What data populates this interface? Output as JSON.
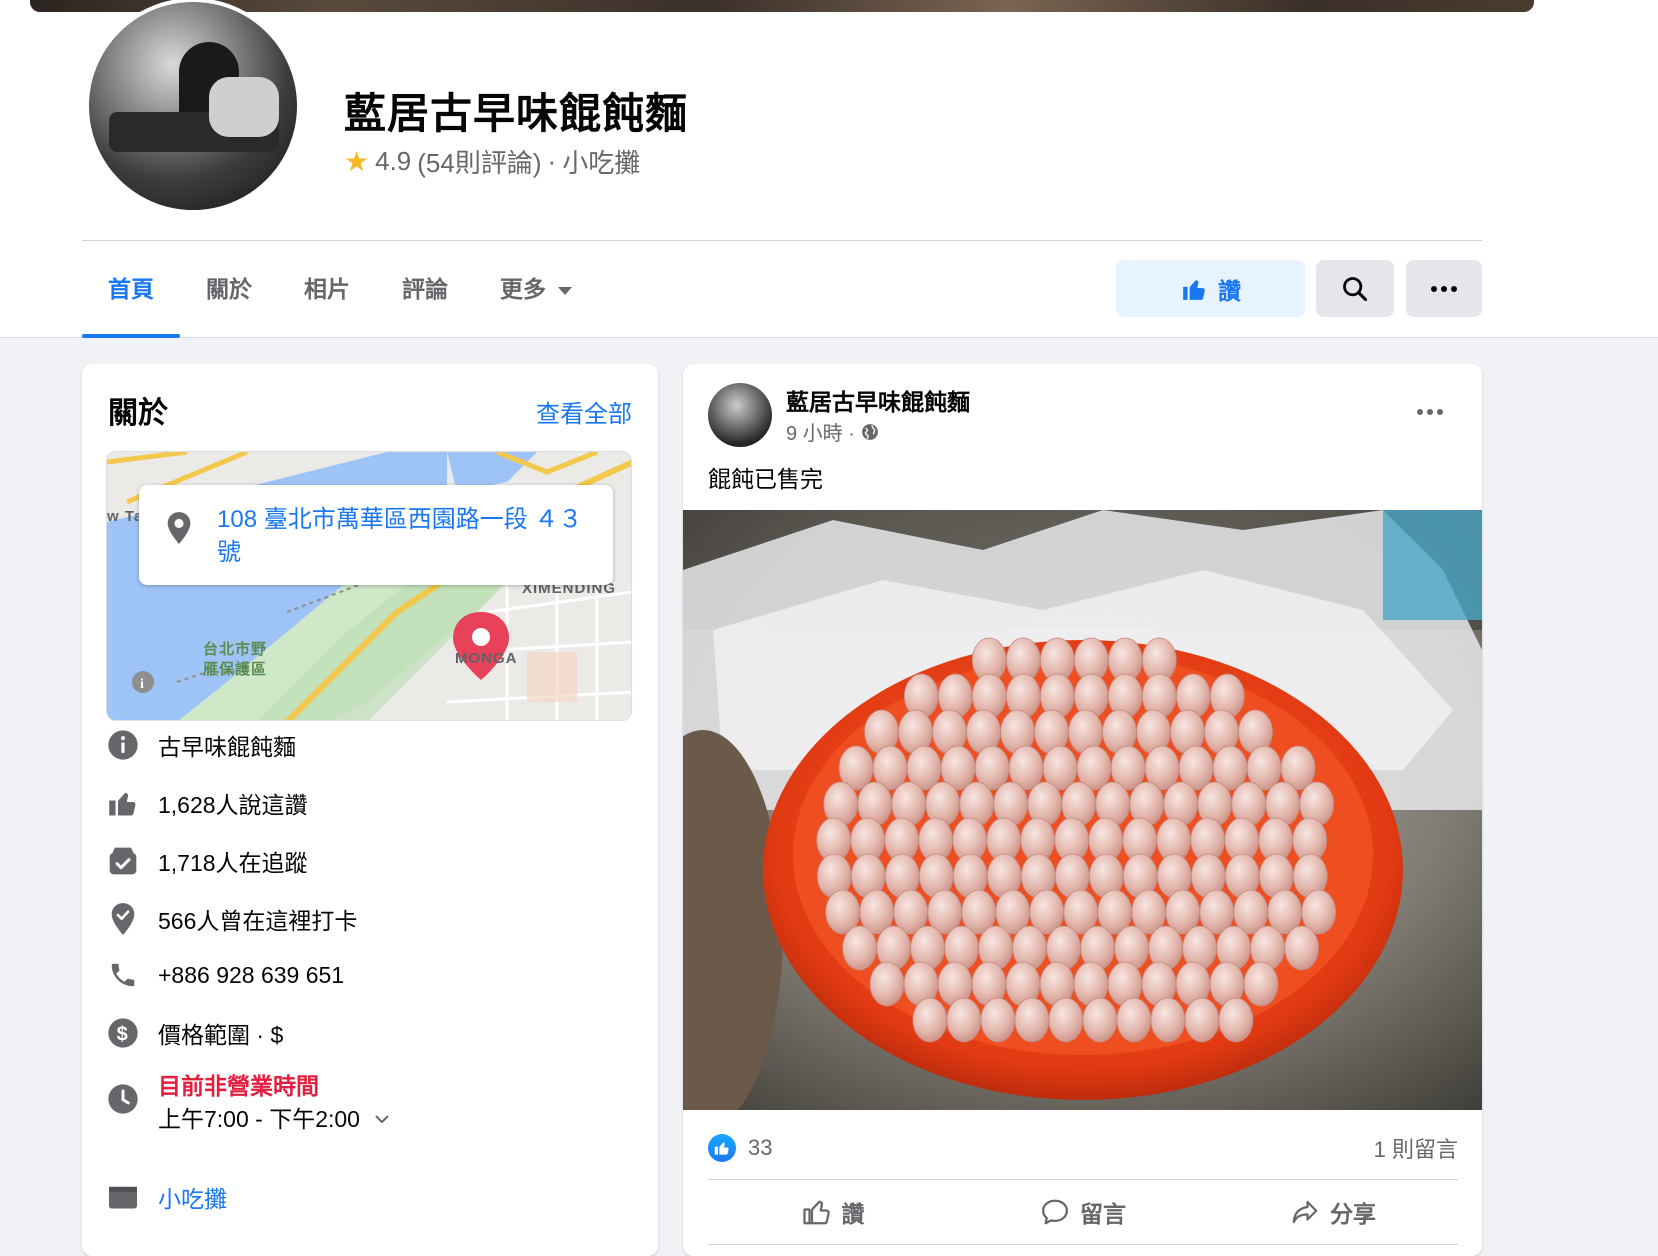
{
  "page": {
    "name": "藍居古早味餛飩麵",
    "rating": "4.9",
    "reviews": "(54則評論)",
    "separator": "·",
    "category": "小吃攤"
  },
  "tabs": [
    {
      "label": "首頁",
      "active": true
    },
    {
      "label": "關於"
    },
    {
      "label": "相片"
    },
    {
      "label": "評論"
    },
    {
      "label": "更多"
    }
  ],
  "actions": {
    "like_label": "讚"
  },
  "about": {
    "title": "關於",
    "see_all": "查看全部",
    "map": {
      "address": "108 臺北市萬華區西園路一段 ４３號",
      "labels": [
        "XIMENDING",
        "MONGA",
        "台北市野",
        "雁保護區",
        "w Ta"
      ]
    },
    "rows": [
      {
        "icon": "info-icon",
        "text": "古早味餛飩麵"
      },
      {
        "icon": "thumbs-up-icon",
        "text": "1,628人說這讚"
      },
      {
        "icon": "follow-icon",
        "text": "1,718人在追蹤"
      },
      {
        "icon": "checkin-icon",
        "text": "566人曾在這裡打卡"
      },
      {
        "icon": "phone-icon",
        "text": "+886 928 639 651"
      },
      {
        "icon": "dollar-icon",
        "text": "價格範圍 · $"
      },
      {
        "icon": "clock-icon",
        "status": "目前非營業時間",
        "text": "上午7:00 - 下午2:00"
      },
      {
        "icon": "category-icon",
        "text": "小吃攤"
      }
    ]
  },
  "post": {
    "author": "藍居古早味餛飩麵",
    "time": "9 小時 ·",
    "text": "餛飩已售完",
    "likes": "33",
    "comments": "1 則留言",
    "actions": {
      "like": "讚",
      "comment": "留言",
      "share": "分享"
    }
  },
  "colors": {
    "accent": "#1877f2",
    "status_closed": "#e41e3f",
    "secondary_text": "#65676b"
  }
}
